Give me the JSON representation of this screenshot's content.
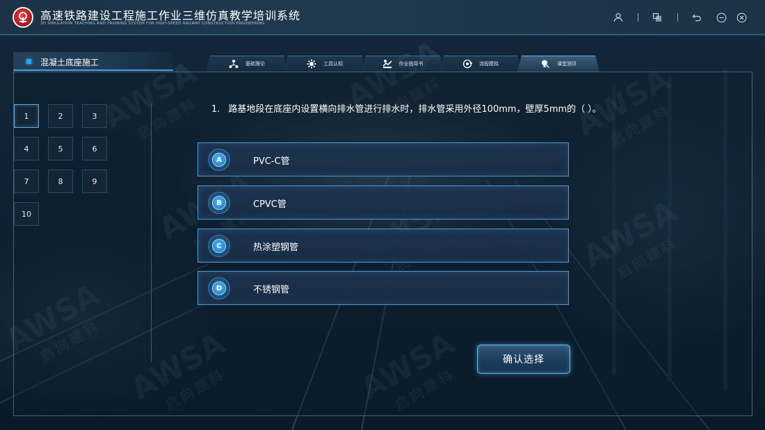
{
  "app": {
    "title": "高速铁路建设工程施工作业三维仿真教学培训系统",
    "subtitle": "3D SIMULATION TEACHING AND TRAINING SYSTEM FOR HIGH-SPEED RAILWAY CONSTRUCTION ENGINEERING"
  },
  "window_controls": [
    "user-icon",
    "window-switch-icon",
    "back-icon",
    "minimize-icon",
    "close-icon"
  ],
  "section": {
    "title": "混凝土底座施工"
  },
  "tabs": [
    {
      "label": "基础理论",
      "icon": "network-icon",
      "active": false
    },
    {
      "label": "工具认知",
      "icon": "gear-icon",
      "active": false
    },
    {
      "label": "作业指导书",
      "icon": "guide-icon",
      "active": false
    },
    {
      "label": "流程模拟",
      "icon": "process-icon",
      "active": false
    },
    {
      "label": "课堂测评",
      "icon": "lightbulb-icon",
      "active": true
    }
  ],
  "question_numbers": [
    "1",
    "2",
    "3",
    "4",
    "5",
    "6",
    "7",
    "8",
    "9",
    "10"
  ],
  "active_question": "1",
  "question": {
    "number": "1.",
    "text": "路基地段在底座内设置横向排水管进行排水时，排水管采用外径100mm，壁厚5mm的（ ）。"
  },
  "options": [
    {
      "letter": "A",
      "text": "PVC-C管"
    },
    {
      "letter": "B",
      "text": "CPVC管"
    },
    {
      "letter": "C",
      "text": "热涂塑钢管"
    },
    {
      "letter": "D",
      "text": "不锈钢管"
    }
  ],
  "confirm_label": "确认选择",
  "watermark": {
    "text": "AWSA",
    "brand": "启向建科"
  },
  "colors": {
    "accent": "#4aa3e0",
    "border": "#4d9ccc",
    "logo_red": "#b21a1f"
  }
}
